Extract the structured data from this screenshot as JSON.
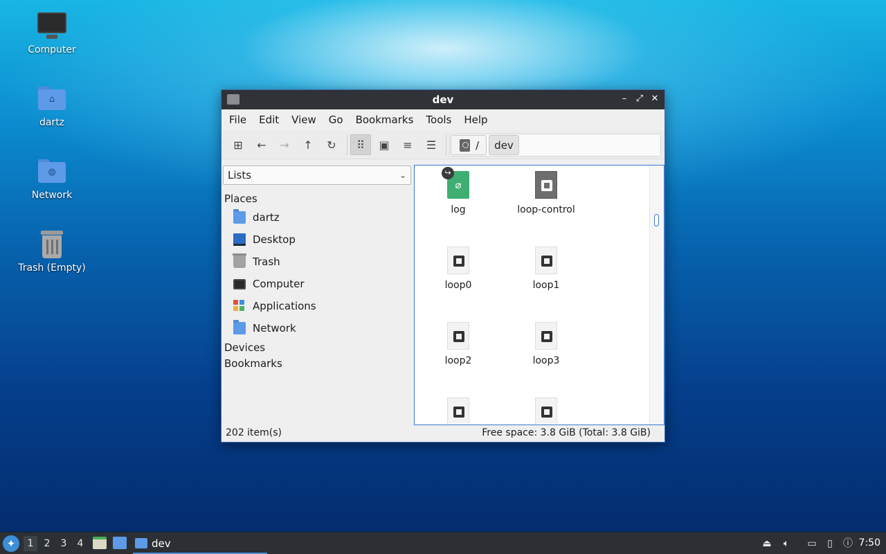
{
  "desktop": {
    "icons": [
      {
        "label": "Computer",
        "icon": "computer-icon"
      },
      {
        "label": "dartz",
        "icon": "home-folder-icon"
      },
      {
        "label": "Network",
        "icon": "network-folder-icon"
      },
      {
        "label": "Trash (Empty)",
        "icon": "trash-icon"
      }
    ]
  },
  "window": {
    "title": "dev",
    "controls": {
      "minimize": "–",
      "maximize": "⤢",
      "close": "✕"
    },
    "menu": [
      "File",
      "Edit",
      "View",
      "Go",
      "Bookmarks",
      "Tools",
      "Help"
    ],
    "toolbar": {
      "buttons": [
        "new-tab-icon",
        "back-icon",
        "forward-icon",
        "up-icon",
        "reload-icon",
        "icon-view-icon",
        "thumbnail-view-icon",
        "compact-view-icon",
        "detailed-list-icon"
      ],
      "glyphs": {
        "new_tab": "⊞",
        "back": "←",
        "forward": "→",
        "up": "↑",
        "reload": "↻",
        "icon_view": "⠿",
        "thumbnail": "▣",
        "compact": "≡",
        "detailed": "☰"
      }
    },
    "path": {
      "root": "/",
      "current": "dev"
    },
    "sidepane": {
      "mode": "Lists",
      "sections": {
        "places": "Places",
        "devices": "Devices",
        "bookmarks": "Bookmarks"
      },
      "places": [
        {
          "label": "dartz",
          "icon": "home-folder-icon"
        },
        {
          "label": "Desktop",
          "icon": "desktop-icon"
        },
        {
          "label": "Trash",
          "icon": "trash-icon"
        },
        {
          "label": "Computer",
          "icon": "computer-icon"
        },
        {
          "label": "Applications",
          "icon": "applications-icon"
        },
        {
          "label": "Network",
          "icon": "network-folder-icon"
        }
      ]
    },
    "files": [
      {
        "name": "log",
        "icon": "socket-icon"
      },
      {
        "name": "loop-control",
        "icon": "char-device-icon"
      },
      {
        "name": "loop0",
        "icon": "block-device-icon"
      },
      {
        "name": "loop1",
        "icon": "block-device-icon"
      },
      {
        "name": "loop2",
        "icon": "block-device-icon"
      },
      {
        "name": "loop3",
        "icon": "block-device-icon"
      },
      {
        "name": "",
        "icon": "block-device-icon"
      },
      {
        "name": "",
        "icon": "block-device-icon"
      }
    ],
    "status": {
      "items": "202 item(s)",
      "free_space": "Free space: 3.8 GiB (Total: 3.8 GiB)"
    }
  },
  "taskbar": {
    "workspaces": [
      "1",
      "2",
      "3",
      "4"
    ],
    "active_workspace": "1",
    "task_label": "dev",
    "clock": "7:50",
    "colors": {
      "task_underline": "#4a90d9",
      "panel": "#2c2f34"
    }
  }
}
